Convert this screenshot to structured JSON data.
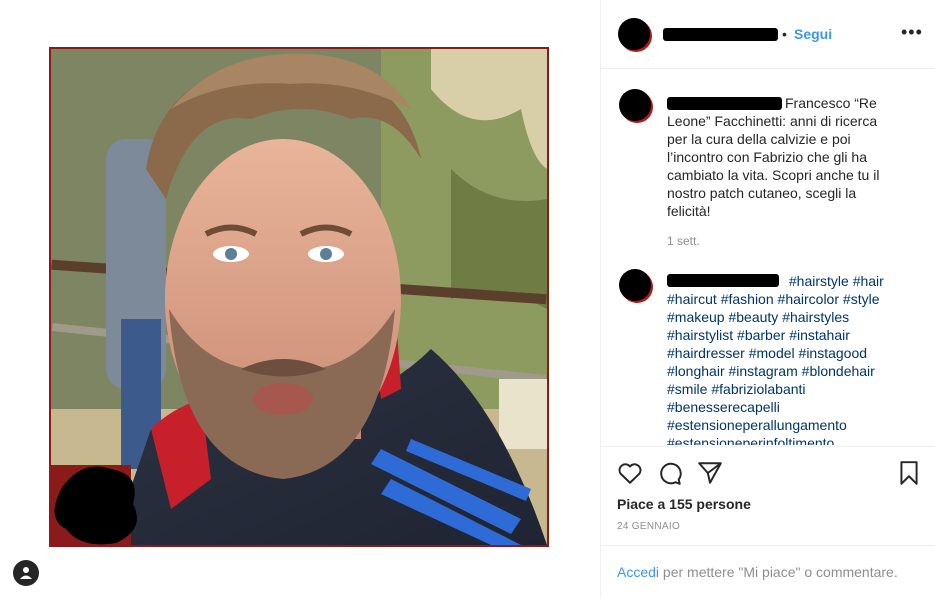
{
  "post": {
    "image_alt": "Selfie video frame of a bearded man with windswept hair in a park",
    "username": "",
    "dot": "•",
    "follow_label": "Segui",
    "more_label": "•••"
  },
  "caption": {
    "text": "Francesco “Re Leone” Facchinetti: anni di ricerca per la cura della calvizie e poi l’incontro con Fabrizio che gli ha cambiato la vita. Scopri anche tu il nostro patch cutaneo, scegli la felicità!",
    "time": "1 sett."
  },
  "hashtag_comment": {
    "tags": [
      "#hairstyle",
      "#hair",
      "#haircut",
      "#fashion",
      "#haircolor",
      "#style",
      "#makeup",
      "#beauty",
      "#hairstyles",
      "#hairstylist",
      "#barber",
      "#instahair",
      "#hairdresser",
      "#model",
      "#instagood",
      "#longhair",
      "#instagram",
      "#blondehair",
      "#smile",
      "#fabriziolabanti",
      "#benesserecapelli",
      "#estensioneperallungamento",
      "#estensioneperinfoltimento"
    ]
  },
  "actions": {
    "like_icon": "heart-icon",
    "comment_icon": "comment-bubble-icon",
    "share_icon": "paper-plane-icon",
    "save_icon": "bookmark-icon",
    "likes_text": "Piace a 155 persone",
    "date_text": "24 GENNAIO"
  },
  "footer": {
    "login_label": "Accedi",
    "login_suffix": " per mettere \"Mi piace\" o commentare."
  },
  "profile_fab_icon": "user-silhouette-icon"
}
